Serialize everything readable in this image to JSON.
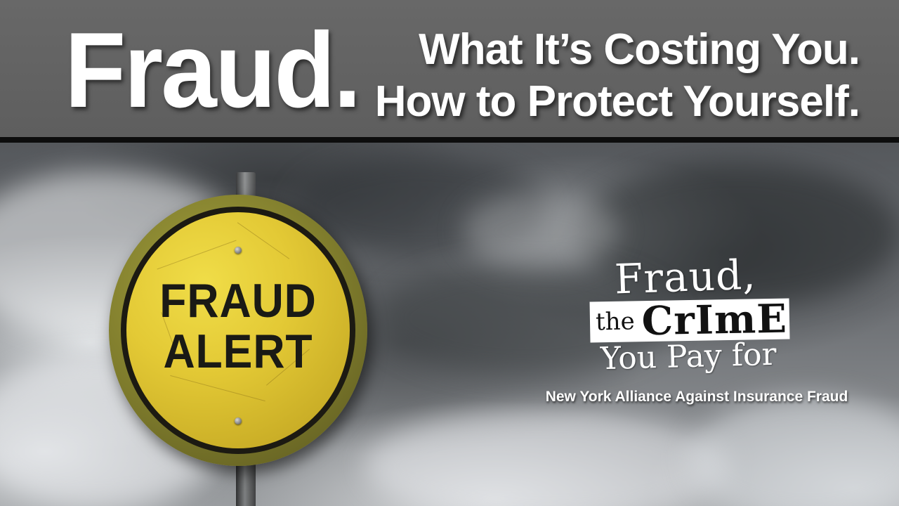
{
  "header": {
    "headline": "Fraud.",
    "subheadline_lines": [
      "What It’s Costing You.",
      "How to Protect Yourself."
    ]
  },
  "sign": {
    "line1": "FRAUD",
    "line2": "ALERT"
  },
  "logo": {
    "line1": "Fraud,",
    "the": "the",
    "crime": "CrImE",
    "line3": "You Pay for"
  },
  "organization": "New York Alliance Against Insurance Fraud",
  "colors": {
    "header_bg": "#606060",
    "sign_yellow": "#e3c935",
    "text_white": "#ffffff"
  }
}
